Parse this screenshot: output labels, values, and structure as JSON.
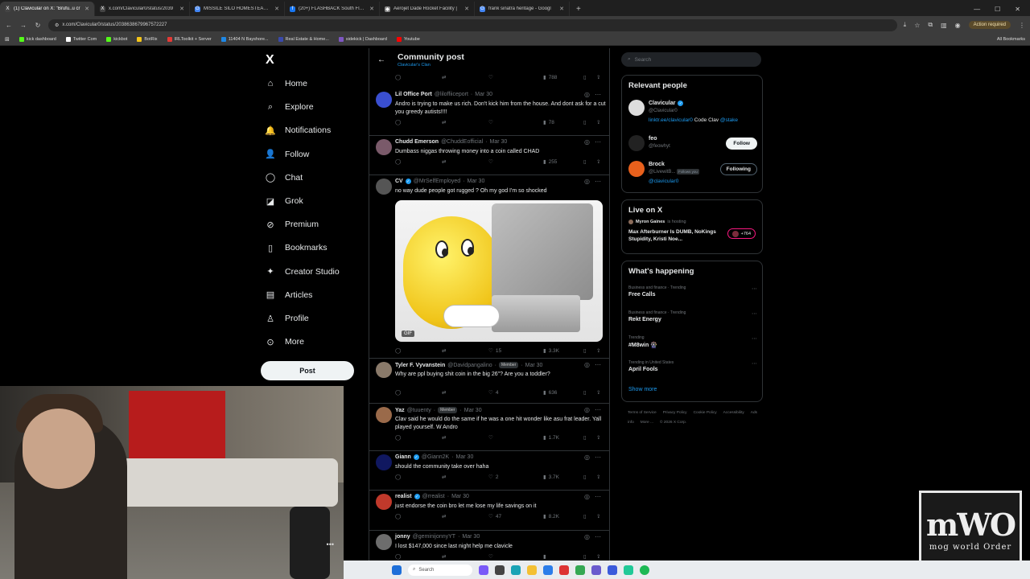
{
  "browser": {
    "tabs": [
      {
        "title": "(1) Clavicular on X: \"Brufu..u cr",
        "fav_color": "#444",
        "fav": "X",
        "active": true
      },
      {
        "title": "x.com/Clavicular0/status/2039",
        "fav_color": "#444",
        "fav": "X",
        "active": false
      },
      {
        "title": "MISSILE SILO HOMESTEAD - G",
        "fav_color": "#4285f4",
        "fav": "G",
        "active": false
      },
      {
        "title": "(20+) FLASHBACK South Florid",
        "fav_color": "#1877f2",
        "fav": "f",
        "active": false
      },
      {
        "title": "Aerojet Dade Rocket Facility |",
        "fav_color": "#888",
        "fav": "◆",
        "active": false
      },
      {
        "title": "frank sinatra heritage - Googl",
        "fav_color": "#4285f4",
        "fav": "G",
        "active": false
      }
    ],
    "new_tab": "+",
    "url": "x.com/Clavicular0/status/2038638679967572227",
    "action_required": "Action required",
    "bookmarks": [
      {
        "label": "kick dashboard",
        "color": "#53fc18"
      },
      {
        "label": "Twitter Com",
        "color": "#ffffff"
      },
      {
        "label": "kickbot",
        "color": "#53fc18"
      },
      {
        "label": "BotRix",
        "color": "#f5c518"
      },
      {
        "label": "IRLToolkit + Server",
        "color": "#e53935"
      },
      {
        "label": "11404 N Bayshore...",
        "color": "#1e88e5"
      },
      {
        "label": "Real Estate & Home...",
        "color": "#3949ab"
      },
      {
        "label": "sidekick | Dashboard",
        "color": "#7e57c2"
      },
      {
        "label": "Youtube",
        "color": "#ff0000"
      }
    ],
    "all_bookmarks": "All Bookmarks"
  },
  "nav": {
    "logo": "X",
    "items": [
      {
        "label": "Home",
        "icon": "⌂"
      },
      {
        "label": "Explore",
        "icon": "⌕"
      },
      {
        "label": "Notifications",
        "icon": "🔔"
      },
      {
        "label": "Follow",
        "icon": "👤"
      },
      {
        "label": "Chat",
        "icon": "◯"
      },
      {
        "label": "Grok",
        "icon": "◪"
      },
      {
        "label": "Premium",
        "icon": "⊘"
      },
      {
        "label": "Bookmarks",
        "icon": "▯"
      },
      {
        "label": "Creator Studio",
        "icon": "✦"
      },
      {
        "label": "Articles",
        "icon": "▤"
      },
      {
        "label": "Profile",
        "icon": "♙"
      },
      {
        "label": "More",
        "icon": "⊙"
      }
    ],
    "post_button": "Post"
  },
  "header": {
    "title": "Community post",
    "subtitle": "Clavicular's Clan",
    "back_icon": "←"
  },
  "top_actions": {
    "views": "788"
  },
  "tweets": [
    {
      "name": "Lil Office Port",
      "handle": "@liloffiiceport",
      "date": "Mar 30",
      "verified": false,
      "member": false,
      "text": "Andro is trying to make us rich. Don't kick him from the house. And dont ask for a cut you greedy autists!!!!",
      "replies": "",
      "retweets": "",
      "likes": "",
      "views": "78",
      "avatar": "#3a4fd0"
    },
    {
      "name": "Chudd Emerson",
      "handle": "@ChuddEofficial",
      "date": "Mar 30",
      "verified": false,
      "member": false,
      "text": "Dumbass niggas throwing money into a coin called CHAD",
      "replies": "",
      "retweets": "",
      "likes": "",
      "views": "255",
      "avatar": "#7a5a6a"
    },
    {
      "name": "CV",
      "handle": "@MrSelfEmployed",
      "date": "Mar 30",
      "verified": true,
      "member": false,
      "text": "no way dude people got rugged ? Oh my god I'm so shocked",
      "replies": "",
      "retweets": "",
      "likes": "15",
      "views": "3.3K",
      "avatar": "#555555",
      "gif_label": "GIF"
    },
    {
      "name": "Tyler F. Vyvanstein",
      "handle": "@Davidpangalino",
      "date": "Mar 30",
      "verified": false,
      "member": true,
      "member_label": "Member",
      "text": "Why are ppl buying shit coin in the big 26\"? Are you a toddler?",
      "replies": "",
      "retweets": "",
      "likes": "4",
      "views": "636",
      "avatar": "#8a7a6a"
    },
    {
      "name": "Yaz",
      "handle": "@tuuenty",
      "date": "Mar 30",
      "verified": false,
      "member": true,
      "member_label": "Member",
      "text": "Clav said he would do the same if he was a one hit wonder like asu frat leader. Yall played yourself. W Andro",
      "replies": "",
      "retweets": "",
      "likes": "",
      "views": "1.7K",
      "avatar": "#9a6a4a"
    },
    {
      "name": "Giann",
      "handle": "@Giann2K",
      "date": "Mar 30",
      "verified": true,
      "member": false,
      "text": "should the community take over haha",
      "replies": "",
      "retweets": "",
      "likes": "2",
      "views": "3.7K",
      "avatar": "#101860"
    },
    {
      "name": "realist",
      "handle": "@rrealist",
      "date": "Mar 30",
      "verified": true,
      "member": false,
      "text": "just endorse the coin bro let me lose my life savings on it",
      "replies": "",
      "retweets": "",
      "likes": "47",
      "views": "8.2K",
      "avatar": "#c0392b"
    },
    {
      "name": "jonny",
      "handle": "@geminijonnyYT",
      "date": "Mar 30",
      "verified": false,
      "member": false,
      "text": "I lost $147,000 since last night help me clavicle",
      "replies": "",
      "retweets": "",
      "likes": "",
      "views": "",
      "avatar": "#6d6d6d"
    }
  ],
  "right": {
    "search_placeholder": "Search",
    "relevant_title": "Relevant people",
    "people": [
      {
        "name": "Clavicular",
        "handle": "@Clavicular0",
        "verified": true,
        "bio_link": "linktr.ee/clavicular0",
        "bio_text": " Code Clav ",
        "bio_tag": "@stake",
        "avatar": "#dddddd"
      },
      {
        "name": "feo",
        "handle": "@feowhyt",
        "verified": false,
        "button": "Follow",
        "avatar": "#222222"
      },
      {
        "name": "Brock",
        "handle": "@LivewitB...",
        "follows_you": "Follows you",
        "bio_link": "@clavicular0",
        "verified": false,
        "button": "Following",
        "avatar": "#e8601c"
      }
    ],
    "live_title": "Live on X",
    "live_host": "Myron Gaines",
    "live_host_suffix": "is hosting",
    "live_text": "Max Afterburner Is DUMB, NoKings Stupidity, Kristi Noe...",
    "live_count": "+764",
    "happening_title": "What's happening",
    "trends": [
      {
        "cat": "Business and finance · Trending",
        "title": "Free Calls"
      },
      {
        "cat": "Business and finance · Trending",
        "title": "Rekt Energy"
      },
      {
        "cat": "Trending",
        "title": "#M8win 🎡"
      },
      {
        "cat": "Trending in United States",
        "title": "April Fools"
      }
    ],
    "show_more": "Show more",
    "footer": [
      "Terms of Service",
      "Privacy Policy",
      "Cookie Policy",
      "Accessibility",
      "Ads info",
      "More ...",
      "© 2026 X Corp."
    ]
  },
  "watermark": {
    "big": "mWO",
    "small": "mog world Order"
  },
  "taskbar": {
    "search": "Search"
  },
  "colors": {
    "accent": "#1d9bf0",
    "bg": "#000000",
    "border": "#2f3336",
    "muted": "#71767b"
  }
}
